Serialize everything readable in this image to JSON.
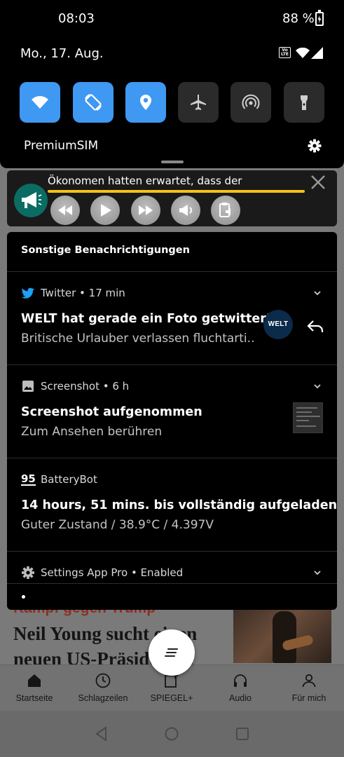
{
  "status_bar": {
    "time": "08:03",
    "battery_percent": "88 %",
    "network_badge": "VoLTE"
  },
  "quick_settings": {
    "date": "Mo., 17. Aug.",
    "carrier": "PremiumSIM",
    "tiles": [
      {
        "icon": "wifi-icon",
        "active": true
      },
      {
        "icon": "auto-rotate-icon",
        "active": true
      },
      {
        "icon": "location-icon",
        "active": true
      },
      {
        "icon": "airplane-icon",
        "active": false
      },
      {
        "icon": "hotspot-icon",
        "active": false
      },
      {
        "icon": "flashlight-icon",
        "active": false
      }
    ]
  },
  "reader_widget": {
    "text": "Ökonomen hatten erwartet, dass der",
    "progress": 1.0
  },
  "notifications": {
    "section_title": "Sonstige Benachrichtigungen",
    "items": [
      {
        "app": "Twitter",
        "time": "17 min",
        "title": "WELT hat gerade ein Foto getwittert",
        "text": "Britische Urlauber verlassen fluchtarti..",
        "avatar_text": "WELT"
      },
      {
        "app": "Screenshot",
        "time": "6 h",
        "title": "Screenshot aufgenommen",
        "text": "Zum Ansehen berühren"
      },
      {
        "app": "BatteryBot",
        "app_icon_text": "95",
        "title": "14 hours, 51 mins. bis vollständig aufgeladen",
        "text": "Guter Zustand / 38.9°C / 4.397V"
      },
      {
        "app": "Settings App Pro",
        "state": "Enabled"
      }
    ]
  },
  "background_app": {
    "kicker": "Kampf gegen Trump",
    "headline": "Neil Young sucht einen neuen US-Präsidenten",
    "tabs": [
      {
        "label": "Startseite",
        "icon": "home-icon"
      },
      {
        "label": "Schlagzeilen",
        "icon": "clock-icon"
      },
      {
        "label": "SPIEGEL+",
        "icon": "spiegel-plus-icon"
      },
      {
        "label": "Audio",
        "icon": "headphones-icon"
      },
      {
        "label": "Für mich",
        "icon": "profile-icon"
      }
    ]
  },
  "colors": {
    "qs_active": "#3f98f2",
    "qs_inactive": "#2b2b2b",
    "reader_progress": "#f3c316",
    "reader_avatar": "#0b6c63",
    "twitter_blue": "#1da1f2"
  }
}
